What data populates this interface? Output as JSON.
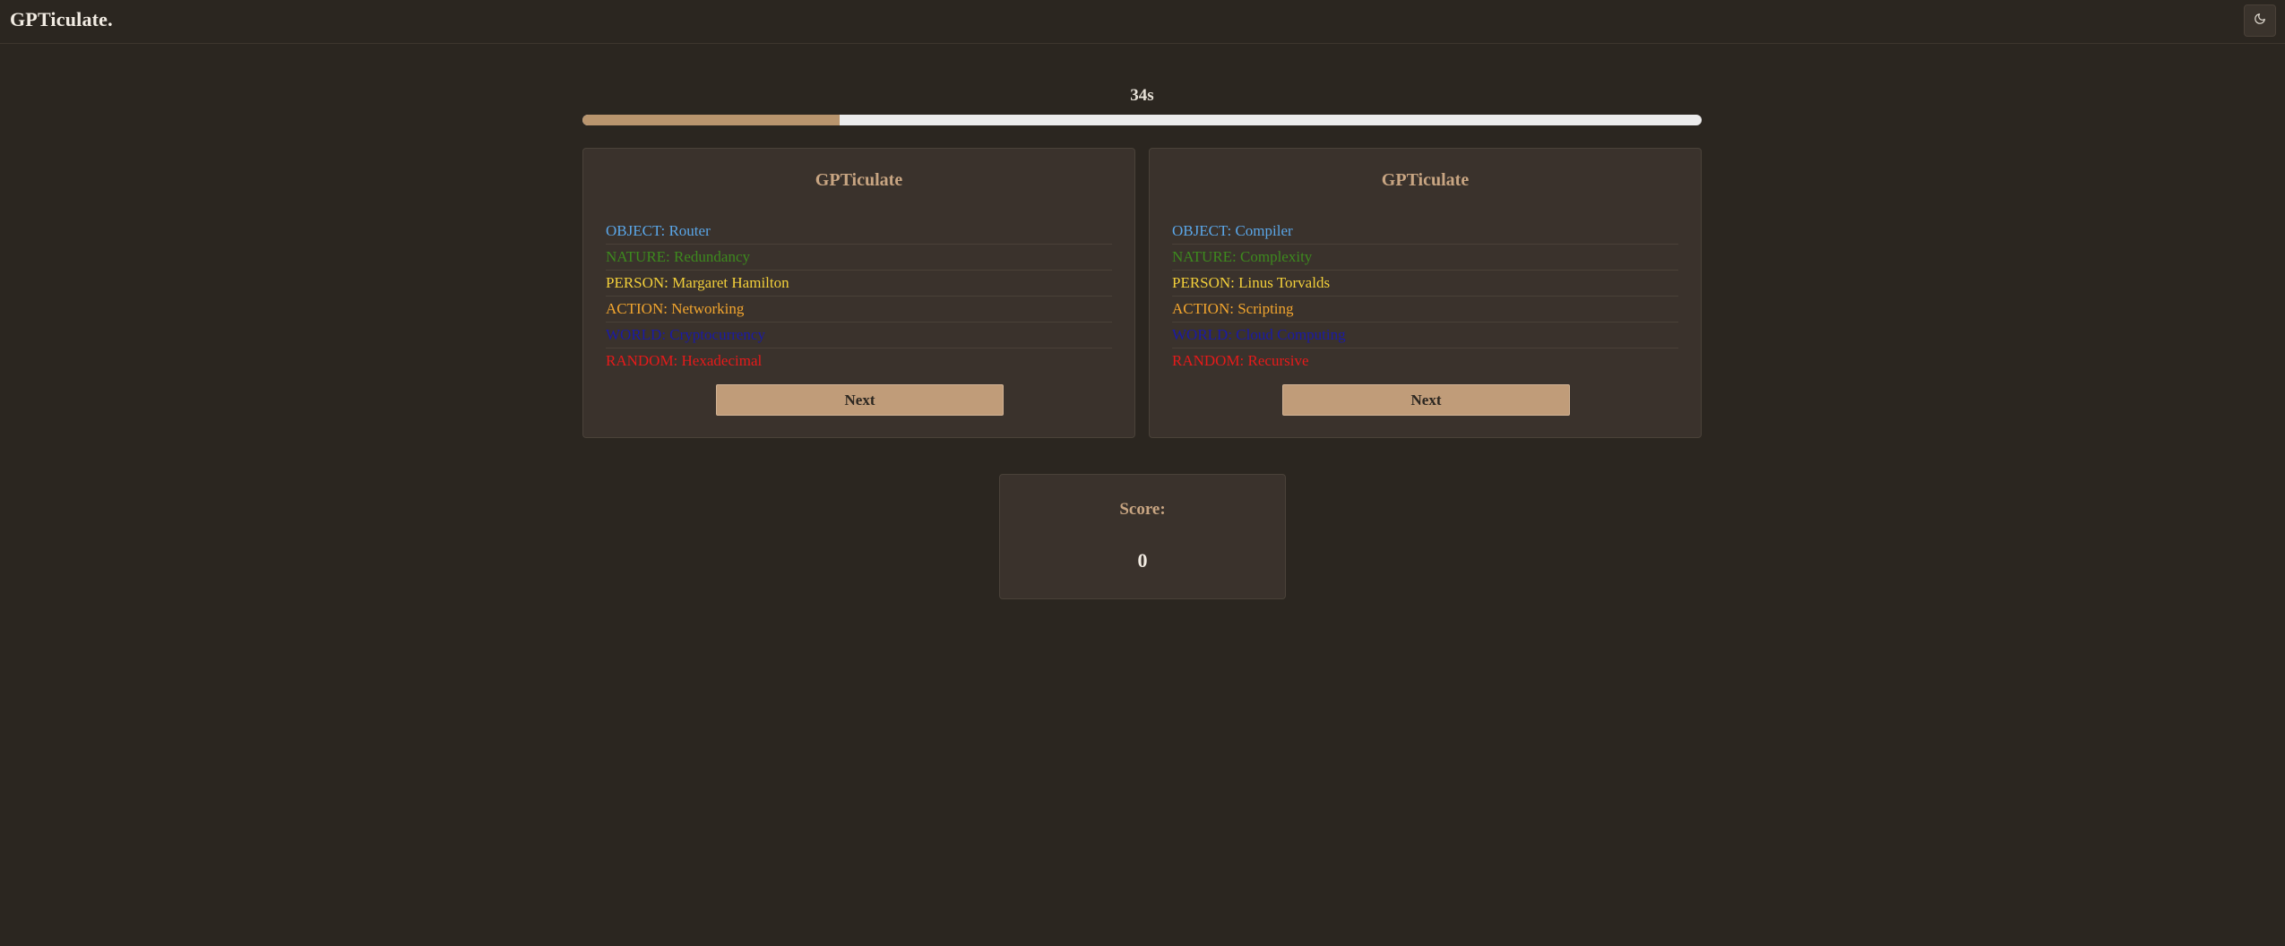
{
  "app": {
    "logo": "GPTiculate."
  },
  "header": {
    "theme_toggle_icon": "moon-icon"
  },
  "timer": {
    "text": "34s",
    "progress_fraction": 0.23
  },
  "colors": {
    "object": "#5aa5e6",
    "nature": "#3d8a1e",
    "person": "#f2cf3a",
    "action": "#f2a52e",
    "world": "#1a1aa6",
    "random": "#e61a1a",
    "accent": "#c09c79"
  },
  "cards": [
    {
      "title": "GPTiculate",
      "words": [
        {
          "category": "object",
          "text": "OBJECT: Router"
        },
        {
          "category": "nature",
          "text": "NATURE: Redundancy"
        },
        {
          "category": "person",
          "text": "PERSON: Margaret Hamilton"
        },
        {
          "category": "action",
          "text": "ACTION: Networking"
        },
        {
          "category": "world",
          "text": "WORLD: Cryptocurrency"
        },
        {
          "category": "random",
          "text": "RANDOM: Hexadecimal"
        }
      ],
      "next_label": "Next"
    },
    {
      "title": "GPTiculate",
      "words": [
        {
          "category": "object",
          "text": "OBJECT: Compiler"
        },
        {
          "category": "nature",
          "text": "NATURE: Complexity"
        },
        {
          "category": "person",
          "text": "PERSON: Linus Torvalds"
        },
        {
          "category": "action",
          "text": "ACTION: Scripting"
        },
        {
          "category": "world",
          "text": "WORLD: Cloud Computing"
        },
        {
          "category": "random",
          "text": "RANDOM: Recursive"
        }
      ],
      "next_label": "Next"
    }
  ],
  "score": {
    "label": "Score:",
    "value": "0"
  }
}
